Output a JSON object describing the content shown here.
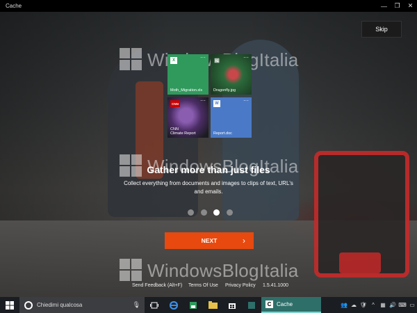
{
  "window": {
    "title": "Cache"
  },
  "controls": {
    "minimize": "—",
    "maximize": "❐",
    "close": "✕"
  },
  "skip_label": "Skip",
  "watermark": {
    "text": "WindowsBlogItalia"
  },
  "tiles": [
    {
      "badge": "X",
      "caption": "Moth_Migration.xls",
      "color": "#2f9a5c"
    },
    {
      "badge": "🖼",
      "caption": "Dragonfly.jpg"
    },
    {
      "badge": "CNN",
      "caption": "CNN\nClimate Report"
    },
    {
      "badge": "W",
      "caption": "Report.doc",
      "color": "#4a7ac7"
    }
  ],
  "more_glyph": "···",
  "heading": "Gather more than just files",
  "description": "Collect everything from documents and images to clips of text, URL's and emails.",
  "pager": {
    "count": 4,
    "active": 3
  },
  "next": {
    "label": "NEXT",
    "chevron": "›"
  },
  "links": {
    "send_feedback": "Send Feedback (Alt+F)",
    "terms": "Terms Of Use",
    "privacy": "Privacy Policy",
    "version": "1.5.41.1000"
  },
  "taskbar": {
    "search_placeholder": "Chiedimi qualcosa",
    "active_app": "Cache",
    "accent": "#2e6f6a"
  },
  "colors": {
    "next_button": "#e8490f",
    "excel_tile": "#2f9a5c",
    "word_tile": "#4a7ac7"
  }
}
